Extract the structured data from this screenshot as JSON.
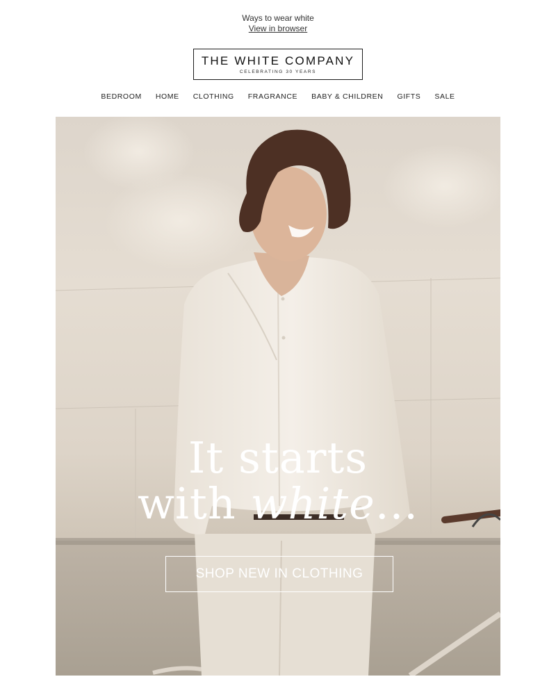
{
  "preheader": {
    "text": "Ways to wear white",
    "view_link": "View in browser"
  },
  "logo": {
    "name": "THE WHITE COMPANY",
    "tagline": "CELEBRATING 30 YEARS"
  },
  "nav": {
    "items": [
      "BEDROOM",
      "HOME",
      "CLOTHING",
      "FRAGRANCE",
      "BABY & CHILDREN",
      "GIFTS",
      "SALE"
    ]
  },
  "hero": {
    "headline_line1": "It starts",
    "headline_line2_prefix": "with ",
    "headline_line2_italic": "white",
    "headline_line2_suffix": "...",
    "cta_label": "SHOP NEW IN CLOTHING"
  },
  "colors": {
    "text": "#1a1a1a",
    "hero_bg": "#e2dad0",
    "cta_border": "#ffffff"
  }
}
